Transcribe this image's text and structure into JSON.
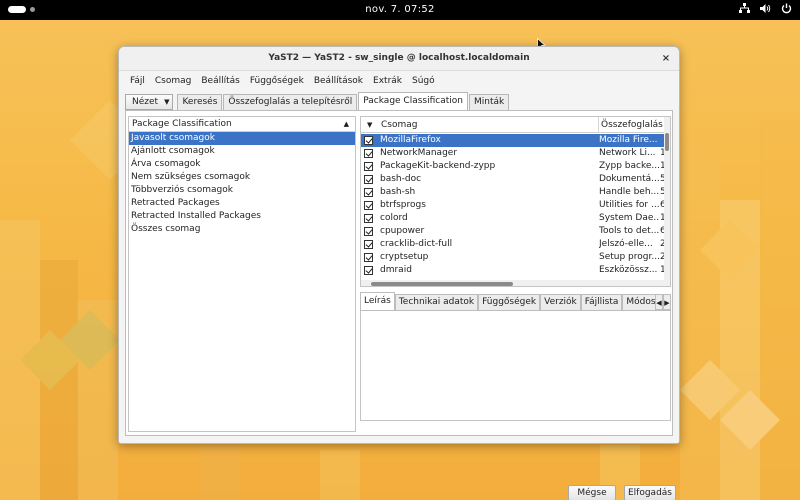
{
  "topbar": {
    "clock": "nov. 7.  07:52",
    "tray_icons": [
      "network-icon",
      "volume-icon",
      "power-icon"
    ]
  },
  "window": {
    "title": "YaST2 — YaST2 - sw_single @ localhost.localdomain",
    "close_glyph": "×"
  },
  "menubar": {
    "items": [
      "Fájl",
      "Csomag",
      "Beállítás",
      "Függőségek",
      "Beállítások",
      "Extrák",
      "Súgó"
    ]
  },
  "view": {
    "dropdown_label": "Nézet",
    "tabs": [
      {
        "label": "Keresés",
        "active": false
      },
      {
        "label": "Összefoglalás a telepítésről",
        "active": false
      },
      {
        "label": "Package Classification",
        "active": true
      },
      {
        "label": "Minták",
        "active": false
      }
    ]
  },
  "classification": {
    "header": "Package Classification",
    "items": [
      {
        "label": "Javasolt csomagok",
        "selected": true
      },
      {
        "label": "Ajánlott csomagok",
        "selected": false
      },
      {
        "label": "Árva csomagok",
        "selected": false
      },
      {
        "label": "Nem szükséges csomagok",
        "selected": false
      },
      {
        "label": "Többverziós csomagok",
        "selected": false
      },
      {
        "label": "Retracted Packages",
        "selected": false
      },
      {
        "label": "Retracted Installed Packages",
        "selected": false
      },
      {
        "label": "Összes csomag",
        "selected": false
      }
    ]
  },
  "packages": {
    "col_package": "Csomag",
    "col_summary": "Összefoglalás",
    "rows": [
      {
        "name": "MozillaFirefox",
        "summary": "Mozilla Fire...",
        "extra": "",
        "checked": true,
        "selected": true
      },
      {
        "name": "NetworkManager",
        "summary": "Network Li...",
        "extra": "1",
        "checked": true,
        "selected": false
      },
      {
        "name": "PackageKit-backend-zypp",
        "summary": "Zypp backe...",
        "extra": "1",
        "checked": true,
        "selected": false
      },
      {
        "name": "bash-doc",
        "summary": "Dokumentá...",
        "extra": "5",
        "checked": true,
        "selected": false
      },
      {
        "name": "bash-sh",
        "summary": "Handle beh...",
        "extra": "5",
        "checked": true,
        "selected": false
      },
      {
        "name": "btrfsprogs",
        "summary": "Utilities for ...",
        "extra": "6",
        "checked": true,
        "selected": false
      },
      {
        "name": "colord",
        "summary": "System Dae...",
        "extra": "1",
        "checked": true,
        "selected": false
      },
      {
        "name": "cpupower",
        "summary": "Tools to det...",
        "extra": "6",
        "checked": true,
        "selected": false
      },
      {
        "name": "cracklib-dict-full",
        "summary": "Jelszó-elle...",
        "extra": "2",
        "checked": true,
        "selected": false
      },
      {
        "name": "cryptsetup",
        "summary": "Setup progr...",
        "extra": "2",
        "checked": true,
        "selected": false
      },
      {
        "name": "dmraid",
        "summary": "Eszközössz...",
        "extra": "1",
        "checked": true,
        "selected": false
      }
    ]
  },
  "details": {
    "tabs": [
      {
        "label": "Leírás",
        "active": true
      },
      {
        "label": "Technikai adatok",
        "active": false
      },
      {
        "label": "Függőségek",
        "active": false
      },
      {
        "label": "Verziók",
        "active": false
      },
      {
        "label": "Fájllista",
        "active": false
      },
      {
        "label": "Módosí",
        "active": false
      }
    ]
  },
  "buttons": {
    "cancel": "Mégse",
    "accept": "Elfogadás"
  },
  "colors": {
    "selection": "#3b73c6",
    "wallpaper": "#f6b946"
  }
}
